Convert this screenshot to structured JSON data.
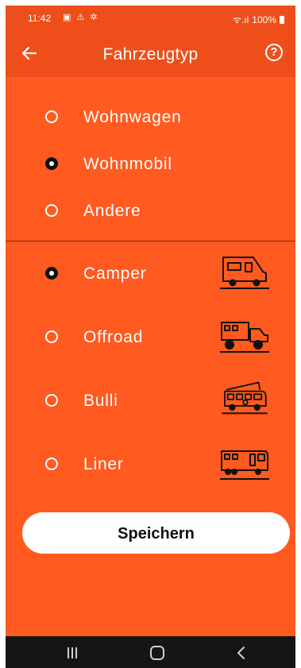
{
  "status": {
    "time": "11:42",
    "left_icons": "▣ ⚠ ✲",
    "signal": "ᯤ.ıl",
    "battery": "100%"
  },
  "appbar": {
    "title": "Fahrzeugtyp",
    "back_icon": "arrow-left-icon",
    "help_label": "?"
  },
  "vehicle_category": {
    "options": [
      {
        "label": "Wohnwagen",
        "selected": false
      },
      {
        "label": "Wohnmobil",
        "selected": true
      },
      {
        "label": "Andere",
        "selected": false
      }
    ]
  },
  "vehicle_type": {
    "options": [
      {
        "label": "Camper",
        "selected": true,
        "icon": "camper-icon"
      },
      {
        "label": "Offroad",
        "selected": false,
        "icon": "offroad-truck-icon"
      },
      {
        "label": "Bulli",
        "selected": false,
        "icon": "bulli-van-icon"
      },
      {
        "label": "Liner",
        "selected": false,
        "icon": "liner-bus-icon"
      }
    ]
  },
  "save_button": {
    "label": "Speichern"
  },
  "colors": {
    "background": "#FF5A1F",
    "appbar": "#EE4F1A",
    "navbar": "#151515"
  },
  "navbar": {
    "recents_icon": "recents-icon",
    "home_icon": "home-icon",
    "back_icon": "back-chevron-icon"
  }
}
